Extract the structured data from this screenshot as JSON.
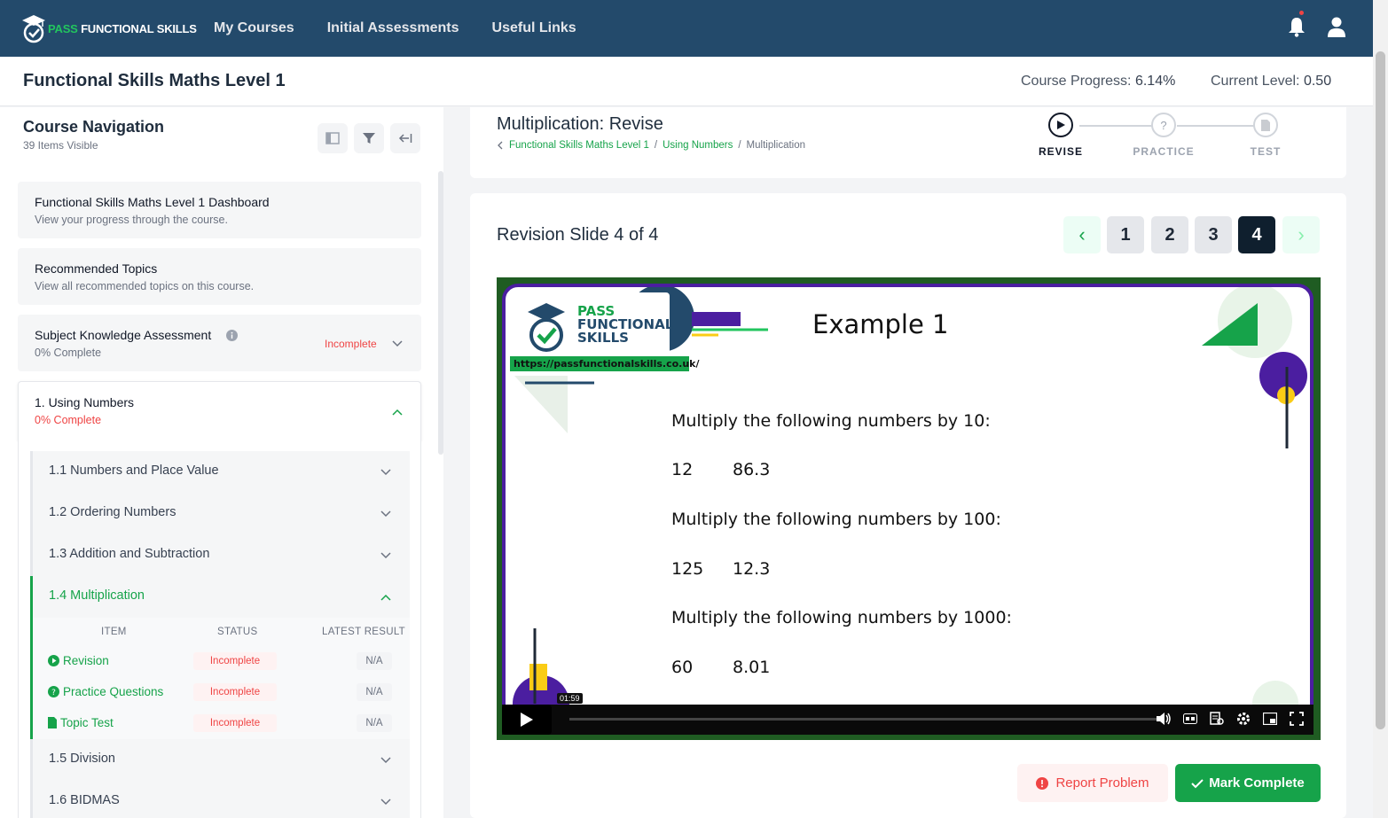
{
  "brand": {
    "logo_prefix": "PASS",
    "logo_suffix": "FUNCTIONAL SKILLS"
  },
  "nav": {
    "links": [
      "My Courses",
      "Initial Assessments",
      "Useful Links"
    ]
  },
  "header": {
    "course_title": "Functional Skills Maths Level 1",
    "progress_label": "Course Progress:",
    "progress_value": "6.14%",
    "level_label": "Current Level:",
    "level_value": "0.50"
  },
  "sidebar": {
    "title": "Course Navigation",
    "visible_count": "39 Items Visible",
    "cards": [
      {
        "title": "Functional Skills Maths Level 1 Dashboard",
        "sub": "View your progress through the course."
      },
      {
        "title": "Recommended Topics",
        "sub": "View all recommended topics on this course."
      },
      {
        "title": "Subject Knowledge Assessment",
        "sub": "0% Complete",
        "status": "Incomplete"
      }
    ],
    "section": {
      "title": "1. Using Numbers",
      "sub": "0% Complete"
    },
    "topics": [
      "1.1 Numbers and Place Value",
      "1.2 Ordering Numbers",
      "1.3 Addition and Subtraction",
      "1.4 Multiplication",
      "1.5 Division",
      "1.6 BIDMAS"
    ],
    "table_headers": [
      "ITEM",
      "STATUS",
      "LATEST RESULT"
    ],
    "items": [
      {
        "label": "Revision",
        "status": "Incomplete",
        "result": "N/A"
      },
      {
        "label": "Practice Questions",
        "status": "Incomplete",
        "result": "N/A"
      },
      {
        "label": "Topic Test",
        "status": "Incomplete",
        "result": "N/A"
      }
    ]
  },
  "lesson": {
    "title": "Multiplication: Revise",
    "breadcrumbs": [
      "Functional Skills Maths Level 1",
      "Using Numbers",
      "Multiplication"
    ],
    "steps": [
      "REVISE",
      "PRACTICE",
      "TEST"
    ]
  },
  "slide": {
    "heading": "Revision Slide 4 of 4",
    "pages": [
      "1",
      "2",
      "3",
      "4"
    ],
    "prev": "‹",
    "next": "›"
  },
  "video": {
    "logo_line1": "PASS",
    "logo_line2": "FUNCTIONAL",
    "logo_line3": "SKILLS",
    "url": "https://passfunctionalskills.co.uk/",
    "title": "Example 1",
    "lines": [
      "Multiply the following numbers by 10:",
      "12",
      "86.3",
      "Multiply the following numbers by 100:",
      "125",
      "12.3",
      "Multiply the following numbers by 1000:",
      "60",
      "8.01"
    ],
    "time": "01:59"
  },
  "actions": {
    "report": "Report Problem",
    "complete": "Mark Complete"
  },
  "colors": {
    "nav_bg": "#234a6b",
    "accent_green": "#16a34a",
    "danger": "#ef4444",
    "active_page": "#0f1f2e"
  }
}
